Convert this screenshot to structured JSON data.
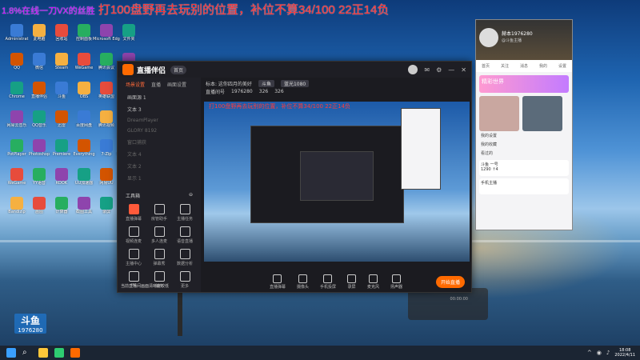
{
  "headline": {
    "prefix": "1.8%在线一刀VX的丝胜",
    "text": "打100盘野再去玩别的位置，补位不算34/100 22正14负"
  },
  "watermark": {
    "text": "斗鱼",
    "number": "1976280"
  },
  "desktop_icons": [
    "Administrat",
    "此电脑",
    "回收站",
    "控制面板",
    "Microsoft Edge",
    "文件夹",
    "QQ",
    "微信",
    "Steam",
    "WeGame",
    "腾讯会议",
    "TIM",
    "Chrome",
    "直播伴侣",
    "斗鱼",
    "OBS",
    "英雄联盟",
    "WPS Office",
    "网易云音乐",
    "QQ音乐",
    "迅雷",
    "百度网盘",
    "腾讯视频",
    "爱奇艺",
    "PotPlayer",
    "Photoshop",
    "Premiere",
    "Everything",
    "7-Zip",
    "Notepad++",
    "WeGame",
    "YY语音",
    "KOOK",
    "UU加速器",
    "网易UU",
    "雷神",
    "Bandizip",
    "画图",
    "计算器",
    "截图工具",
    "录屏",
    "剪映"
  ],
  "app": {
    "title": "直播伴侣",
    "home_badge": "首页",
    "scene_tabs": [
      "场景设置",
      "直播",
      "画面设置"
    ],
    "scenes": [
      "画面源 1",
      "文本 3",
      "DreamPlayer",
      "GLORY 8192",
      "窗口捕获",
      "文本 4",
      "文本 2",
      "显示 1"
    ],
    "tool_section": "工具箱",
    "tools": [
      "直播弹幕",
      "房管助手",
      "主播任务",
      "视频连麦",
      "多人连麦",
      "语音直播",
      "主播中心",
      "弹幕秀",
      "数据分析",
      "PK",
      "抽奖",
      "更多"
    ],
    "tip": "当前直播间画面清晰度较低",
    "topbar": {
      "title_label": "标本: 这你四月的美好",
      "tag": "斗鱼",
      "quality": "蓝光1080",
      "room_label": "直播间号",
      "room": "1976280",
      "viewers": "326",
      "fans": "326"
    },
    "preview_text": "打100盘野再去玩别的位置，补位不算34/100 22正14负",
    "controls": [
      "直播弹幕",
      "摄像头",
      "手机投屏",
      "录屏",
      "麦克风",
      "扬声器"
    ],
    "start_button": "开始直播",
    "time": "00:00:00"
  },
  "phone": {
    "name": "赫本1976280",
    "subtitle": "@斗鱼主播",
    "tabs": [
      "首页",
      "关注",
      "消息",
      "我的",
      "设置"
    ],
    "banner": "精彩世界",
    "items": [
      "我的设置",
      "我的收藏",
      "看过的"
    ],
    "card1": "斗鱼 一号",
    "card2": "手机主播",
    "card1_stat": "1290 ↑4"
  },
  "taskbar": {
    "clock_time": "18:08",
    "clock_date": "2022/4/11"
  },
  "colors": {
    "accent": "#ff6a00",
    "headline": "#ff2d2d",
    "app_bg": "#1b1b20"
  }
}
